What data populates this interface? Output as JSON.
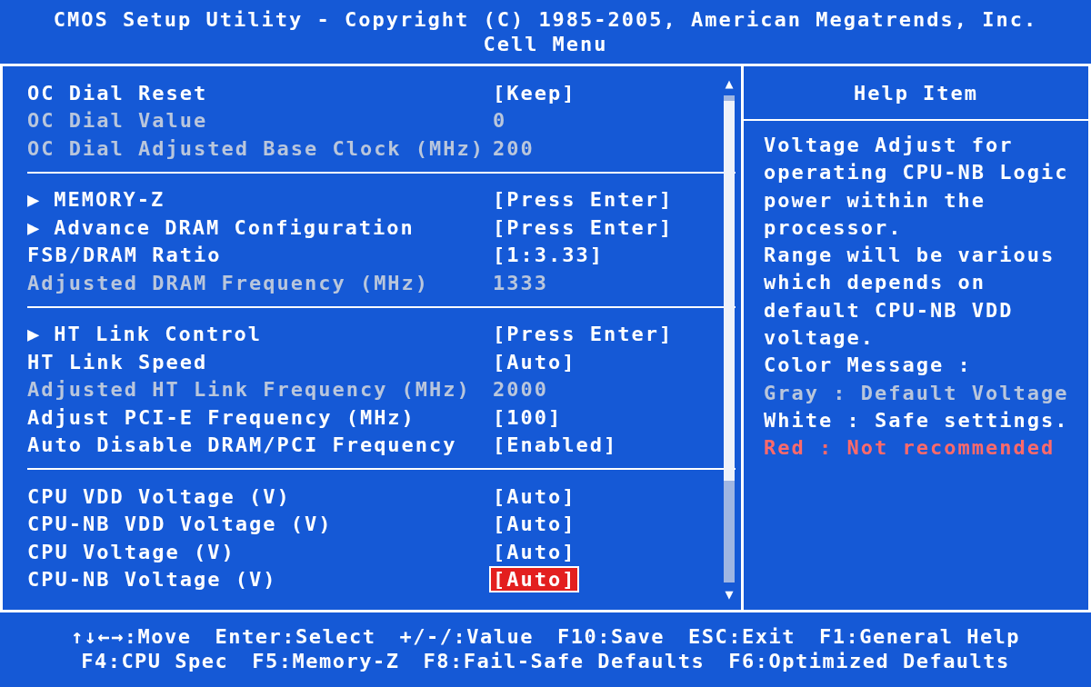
{
  "header": {
    "title": "CMOS Setup Utility - Copyright (C) 1985-2005, American Megatrends, Inc.",
    "subtitle": "Cell Menu"
  },
  "groups": [
    {
      "rows": [
        {
          "label": "OC Dial Reset",
          "value": "[Keep]",
          "readonly": false,
          "selected": false
        },
        {
          "label": "OC Dial Value",
          "value": "0",
          "readonly": true,
          "selected": false
        },
        {
          "label": "OC Dial Adjusted Base Clock (MHz)",
          "value": "200",
          "readonly": true,
          "selected": false
        }
      ]
    },
    {
      "rows": [
        {
          "marker": "▶",
          "label": "MEMORY-Z",
          "value": "[Press Enter]",
          "readonly": false,
          "selected": false
        },
        {
          "marker": "▶",
          "label": "Advance DRAM Configuration",
          "value": "[Press Enter]",
          "readonly": false,
          "selected": false
        },
        {
          "label": "FSB/DRAM Ratio",
          "value": "[1:3.33]",
          "readonly": false,
          "selected": false
        },
        {
          "label": "Adjusted DRAM Frequency (MHz)",
          "value": "1333",
          "readonly": true,
          "selected": false
        }
      ]
    },
    {
      "rows": [
        {
          "marker": "▶",
          "label": "HT Link Control",
          "value": "[Press Enter]",
          "readonly": false,
          "selected": false
        },
        {
          "label": "HT Link Speed",
          "value": "[Auto]",
          "readonly": false,
          "selected": false
        },
        {
          "label": "Adjusted HT Link Frequency (MHz)",
          "value": "2000",
          "readonly": true,
          "selected": false
        },
        {
          "label": "Adjust PCI-E Frequency (MHz)",
          "value": "[100]",
          "readonly": false,
          "selected": false
        },
        {
          "label": "Auto Disable DRAM/PCI Frequency",
          "value": "[Enabled]",
          "readonly": false,
          "selected": false
        }
      ]
    },
    {
      "rows": [
        {
          "label": "CPU VDD Voltage (V)",
          "value": "[Auto]",
          "readonly": false,
          "selected": false
        },
        {
          "label": "CPU-NB VDD Voltage (V)",
          "value": "[Auto]",
          "readonly": false,
          "selected": false
        },
        {
          "label": "CPU Voltage (V)",
          "value": "[Auto]",
          "readonly": false,
          "selected": false
        },
        {
          "label": "CPU-NB Voltage (V)",
          "value": "[Auto]",
          "readonly": false,
          "selected": true
        }
      ]
    }
  ],
  "scrollbar": {
    "up": "▲",
    "down": "▼"
  },
  "help": {
    "title": "Help Item",
    "lines": [
      {
        "text": "Voltage Adjust for",
        "color": "#ffffff"
      },
      {
        "text": "operating CPU-NB Logic",
        "color": "#ffffff"
      },
      {
        "text": "power within the",
        "color": "#ffffff"
      },
      {
        "text": "processor.",
        "color": "#ffffff"
      },
      {
        "text": "Range will be various",
        "color": "#ffffff"
      },
      {
        "text": "which depends on",
        "color": "#ffffff"
      },
      {
        "text": "default CPU-NB VDD",
        "color": "#ffffff"
      },
      {
        "text": "voltage.",
        "color": "#ffffff"
      },
      {
        "text": "Color Message :",
        "color": "#ffffff"
      },
      {
        "text": "Gray : Default Voltage",
        "color": "#b9c6dc"
      },
      {
        "text": "White : Safe settings.",
        "color": "#ffffff"
      },
      {
        "text": "Red : Not recommended",
        "color": "#ff6a6a"
      }
    ]
  },
  "footer": {
    "lines": [
      [
        "↑↓←→:Move",
        "Enter:Select",
        "+/-/:Value",
        "F10:Save",
        "ESC:Exit",
        "F1:General Help"
      ],
      [
        "F4:CPU Spec",
        "F5:Memory-Z",
        "F8:Fail-Safe Defaults",
        "F6:Optimized Defaults"
      ]
    ]
  }
}
